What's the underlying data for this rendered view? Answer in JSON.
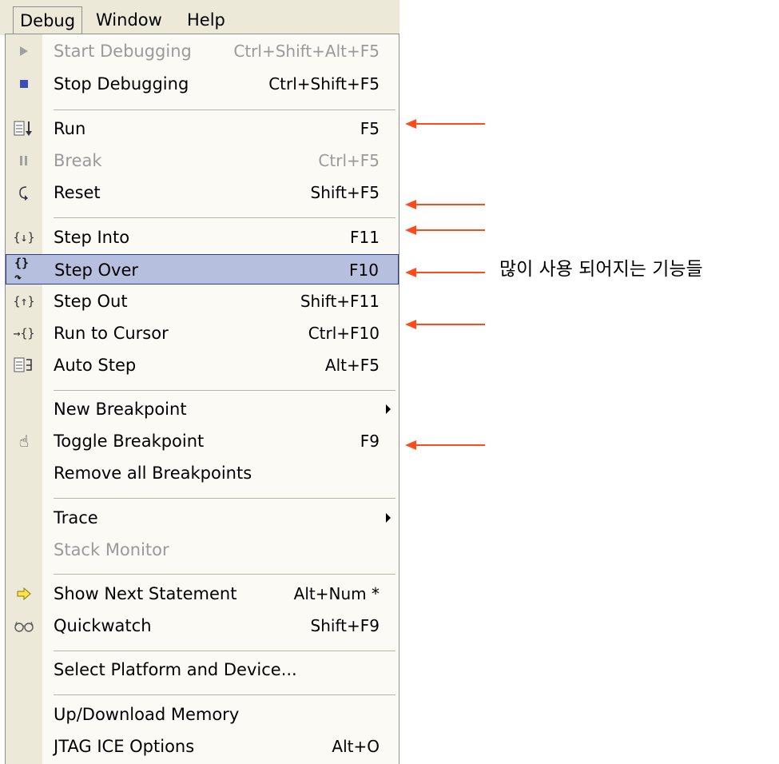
{
  "menubar": {
    "debug": "Debug",
    "window": "Window",
    "help": "Help"
  },
  "menu": {
    "start_debugging": {
      "label": "Start Debugging",
      "shortcut": "Ctrl+Shift+Alt+F5"
    },
    "stop_debugging": {
      "label": "Stop Debugging",
      "shortcut": "Ctrl+Shift+F5"
    },
    "run": {
      "label": "Run",
      "shortcut": "F5"
    },
    "break": {
      "label": "Break",
      "shortcut": "Ctrl+F5"
    },
    "reset": {
      "label": "Reset",
      "shortcut": "Shift+F5"
    },
    "step_into": {
      "label": "Step Into",
      "shortcut": "F11"
    },
    "step_over": {
      "label": "Step Over",
      "shortcut": "F10"
    },
    "step_out": {
      "label": "Step Out",
      "shortcut": "Shift+F11"
    },
    "run_to_cursor": {
      "label": "Run to Cursor",
      "shortcut": "Ctrl+F10"
    },
    "auto_step": {
      "label": "Auto Step",
      "shortcut": "Alt+F5"
    },
    "new_breakpoint": {
      "label": "New Breakpoint"
    },
    "toggle_breakpoint": {
      "label": "Toggle Breakpoint",
      "shortcut": "F9"
    },
    "remove_all_breakpoints": {
      "label": "Remove all Breakpoints"
    },
    "trace": {
      "label": "Trace"
    },
    "stack_monitor": {
      "label": "Stack Monitor"
    },
    "show_next_statement": {
      "label": "Show Next Statement",
      "shortcut": "Alt+Num *"
    },
    "quickwatch": {
      "label": "Quickwatch",
      "shortcut": "Shift+F9"
    },
    "select_platform": {
      "label": "Select Platform and Device..."
    },
    "up_download_memory": {
      "label": "Up/Download Memory"
    },
    "jtag_ice_options": {
      "label": "JTAG ICE Options",
      "shortcut": "Alt+O"
    }
  },
  "annotation": {
    "note": "많이 사용 되어지는 기능들",
    "arrow_color": "#ff4a1c"
  },
  "colors": {
    "highlight": "#b7bfdf",
    "highlight_border": "#2b3f8f",
    "disabled_text": "#9a9a9a"
  }
}
